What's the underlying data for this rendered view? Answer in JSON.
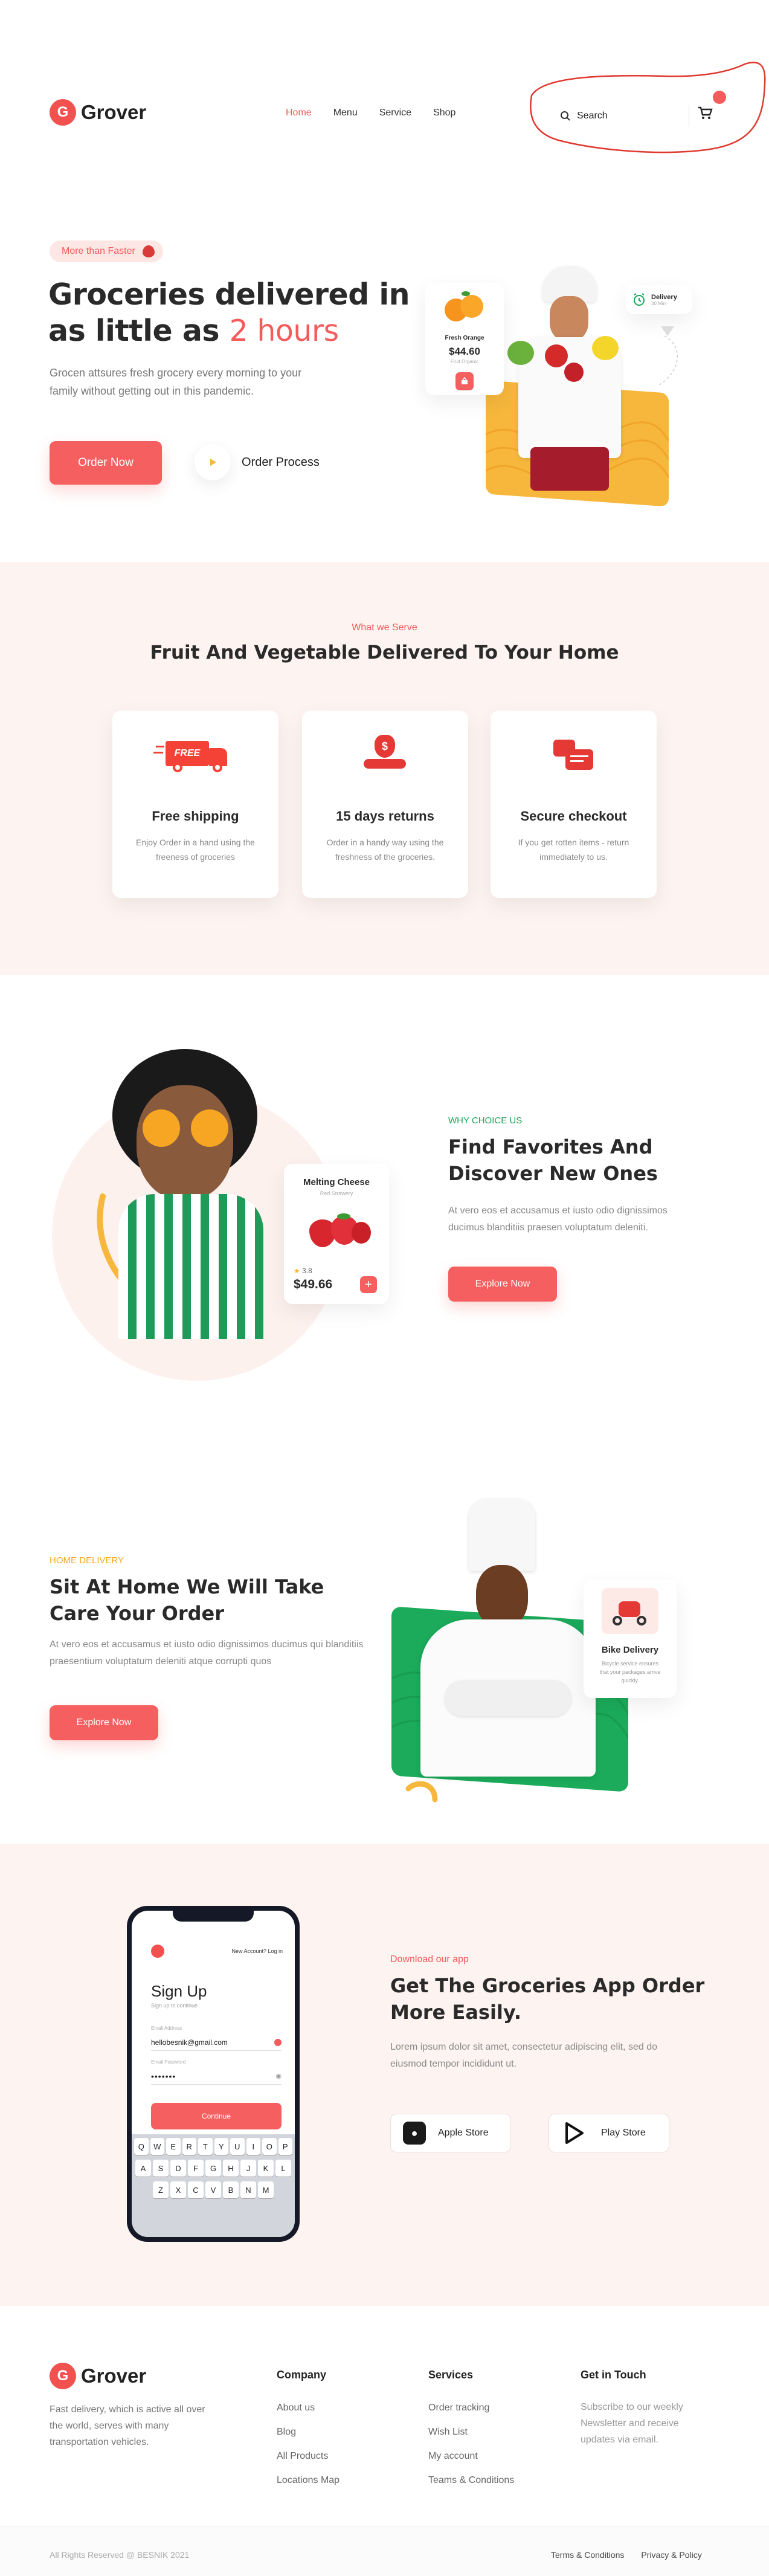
{
  "header": {
    "logo_text": "Grover",
    "logo_letter": "G",
    "nav": [
      "Home",
      "Menu",
      "Service",
      "Shop"
    ],
    "search_label": "Search",
    "cart_count": "1"
  },
  "hero": {
    "badge": "More than Faster",
    "title_line1": "Groceries delivered in",
    "title_line2_prefix": "as little as",
    "title_highlight": "2 hours",
    "description": "Grocen attsures fresh grocery every morning to your family without getting out in this pandemic.",
    "order_button": "Order Now",
    "process_label": "Order Process",
    "product_name": "Fresh Orange",
    "product_price": "$44.60",
    "product_sub": "Fruit Organic",
    "delivery_label": "Delivery",
    "delivery_sub": "30 Min"
  },
  "services": {
    "kicker": "What we Serve",
    "title": "Fruit And Vegetable Delivered To Your Home",
    "free_tag": "FREE",
    "items": [
      {
        "title": "Free shipping",
        "text": "Enjoy Order in a hand using the freeness of groceries"
      },
      {
        "title": "15 days returns",
        "text": "Order in a handy way using the freshness of the groceries."
      },
      {
        "title": "Secure checkout",
        "text": "If you get rotten items - return immediately to us."
      }
    ]
  },
  "favorites": {
    "kicker": "WHY CHOICE US",
    "title_line1": "Find Favorites And",
    "title_line2": "Discover New Ones",
    "description": "At vero eos et accusamus et iusto odio dignissimos ducimus blanditiis praesen voluptatum deleniti.",
    "button": "Explore Now",
    "card_title": "Melting Cheese",
    "card_sub": "Red Strawery",
    "rating": "3.8",
    "price": "$49.66"
  },
  "home_delivery": {
    "kicker": "HOME DELIVERY",
    "title_line1": "Sit At Home We Will Take",
    "title_line2": "Care Your Order",
    "description": "At vero eos et accusamus et iusto odio dignissimos ducimus qui blanditiis praesentium voluptatum deleniti atque corrupti quos",
    "button": "Explore Now",
    "card_title": "Bike Delivery",
    "card_text": "Bicycle service ensures that your packages arrive quickly."
  },
  "app": {
    "kicker": "Download our app",
    "title_line1": "Get The Groceries App Order",
    "title_line2": "More Easily.",
    "description": "Lorem ipsum dolor sit amet, consectetur adipiscing elit, sed do eiusmod tempor incididunt ut.",
    "apple": "Apple Store",
    "play": "Play Store",
    "phone": {
      "top_link": "New Account? Log in",
      "title": "Sign Up",
      "subtitle": "Sign up to continue",
      "email_label": "Email Address",
      "email_value": "hellobesnik@gmail.com",
      "password_label": "Email Password",
      "password_value": "•••••••",
      "continue": "Continue",
      "keys_row1": [
        "Q",
        "W",
        "E",
        "R",
        "T",
        "Y",
        "U",
        "I",
        "O",
        "P"
      ],
      "keys_row2": [
        "A",
        "S",
        "D",
        "F",
        "G",
        "H",
        "J",
        "K",
        "L"
      ],
      "keys_row3": [
        "Z",
        "X",
        "C",
        "V",
        "B",
        "N",
        "M"
      ]
    }
  },
  "footer": {
    "logo_text": "Grover",
    "about": "Fast delivery, which is active all over the world, serves with many transportation vehicles.",
    "company_title": "Company",
    "company_links": [
      "About us",
      "Blog",
      "All Products",
      "Locations Map"
    ],
    "services_title": "Services",
    "services_links": [
      "Order tracking",
      "Wish List",
      "My account",
      "Teams & Conditions"
    ],
    "touch_title": "Get in Touch",
    "touch_text": "Subscribe to our weekly Newsletter and receive updates via email.",
    "copyright": "All Rights Reserved @ BESNIK 2021",
    "terms": "Terms & Conditions",
    "privacy": "Privacy & Policy"
  },
  "colors": {
    "accent": "#f65f5f",
    "pink_background": "#fdf3f0",
    "green": "#1aa55a",
    "yellow": "#f6b73c"
  }
}
